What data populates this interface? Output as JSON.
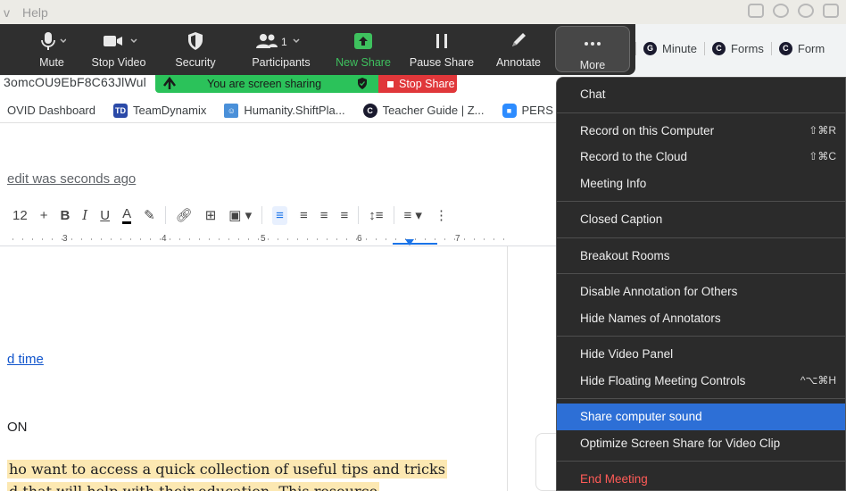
{
  "menubar": {
    "help": "Help",
    "view_partial": "v"
  },
  "url_fragment": "3omcOU9EbF8C63JlWul",
  "bookmarks": [
    {
      "label": "OVID Dashboard",
      "icon": "none"
    },
    {
      "label": "TeamDynamix",
      "icon": "TD"
    },
    {
      "label": "Humanity.ShiftPla...",
      "icon": "humanity-icon"
    },
    {
      "label": "Teacher Guide | Z...",
      "icon": "C"
    },
    {
      "label": "PERS",
      "icon": "zoom-icon"
    }
  ],
  "zoom_toolbar": {
    "mute": "Mute",
    "stop_video": "Stop Video",
    "security": "Security",
    "participants": "Participants",
    "participants_count": "1",
    "new_share": "New Share",
    "pause_share": "Pause Share",
    "annotate": "Annotate",
    "more": "More"
  },
  "browser_tabs": [
    {
      "label": "Minute",
      "icon": "G"
    },
    {
      "label": "Forms",
      "icon": "C"
    },
    {
      "label": "Form",
      "icon": "C"
    }
  ],
  "share_banner": {
    "status": "You are screen sharing",
    "stop": "Stop Share"
  },
  "doc": {
    "last_edit": "edit was seconds ago",
    "font_size": "12",
    "ruler_numbers": [
      "3",
      "4",
      "5",
      "6",
      "7"
    ],
    "link_time": "d time",
    "heading": "ON",
    "highlight_line1": "ho want to access a quick collection of useful tips and tricks",
    "highlight_line2": "d that will help with their education. This resource"
  },
  "more_menu": {
    "items": [
      {
        "label": "Chat",
        "shortcut": ""
      },
      {
        "label": "Record on this Computer",
        "shortcut": "⇧⌘R"
      },
      {
        "label": "Record to the Cloud",
        "shortcut": "⇧⌘C"
      },
      {
        "label": "Meeting Info",
        "shortcut": ""
      },
      {
        "label": "Closed Caption",
        "shortcut": ""
      },
      {
        "label": "Breakout Rooms",
        "shortcut": ""
      },
      {
        "label": "Disable Annotation for Others",
        "shortcut": ""
      },
      {
        "label": "Hide Names of Annotators",
        "shortcut": ""
      },
      {
        "label": "Hide Video Panel",
        "shortcut": ""
      },
      {
        "label": "Hide Floating Meeting Controls",
        "shortcut": "^⌥⌘H"
      },
      {
        "label": "Share computer sound",
        "shortcut": ""
      },
      {
        "label": "Optimize Screen Share for Video Clip",
        "shortcut": ""
      },
      {
        "label": "End Meeting",
        "shortcut": ""
      }
    ],
    "selected_index": 10
  },
  "colors": {
    "zoom_bar": "#2f2f2f",
    "share_green": "#2bc25a",
    "stop_red": "#e0373a",
    "menu_bg": "#2b2b2b",
    "menu_selected": "#2d6fd6",
    "end_meeting": "#ff5b57"
  }
}
